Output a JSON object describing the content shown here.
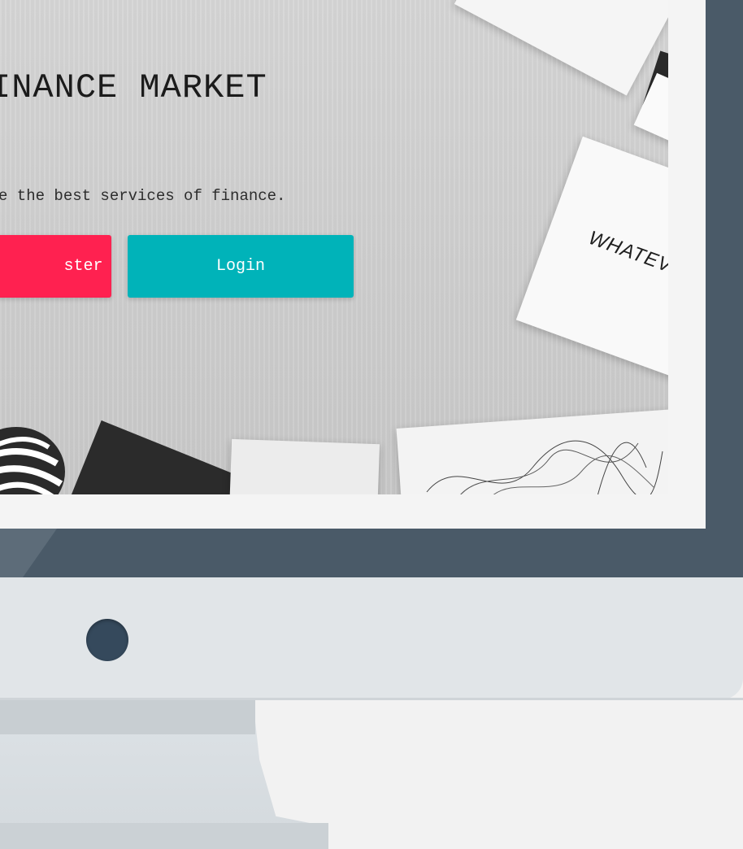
{
  "hero": {
    "title": "INANCE MARKET",
    "subtitle": "e the best services of finance.",
    "register_label": "ster",
    "login_label": "Login",
    "paper_text": "WHATEV"
  },
  "colors": {
    "bezel": "#4a5a68",
    "register": "#ff2150",
    "login": "#00b3b9",
    "chin": "#e1e5e8",
    "camera": "#35495c",
    "background": "#f2f2f2"
  },
  "icons": {
    "camera": "camera-icon"
  }
}
